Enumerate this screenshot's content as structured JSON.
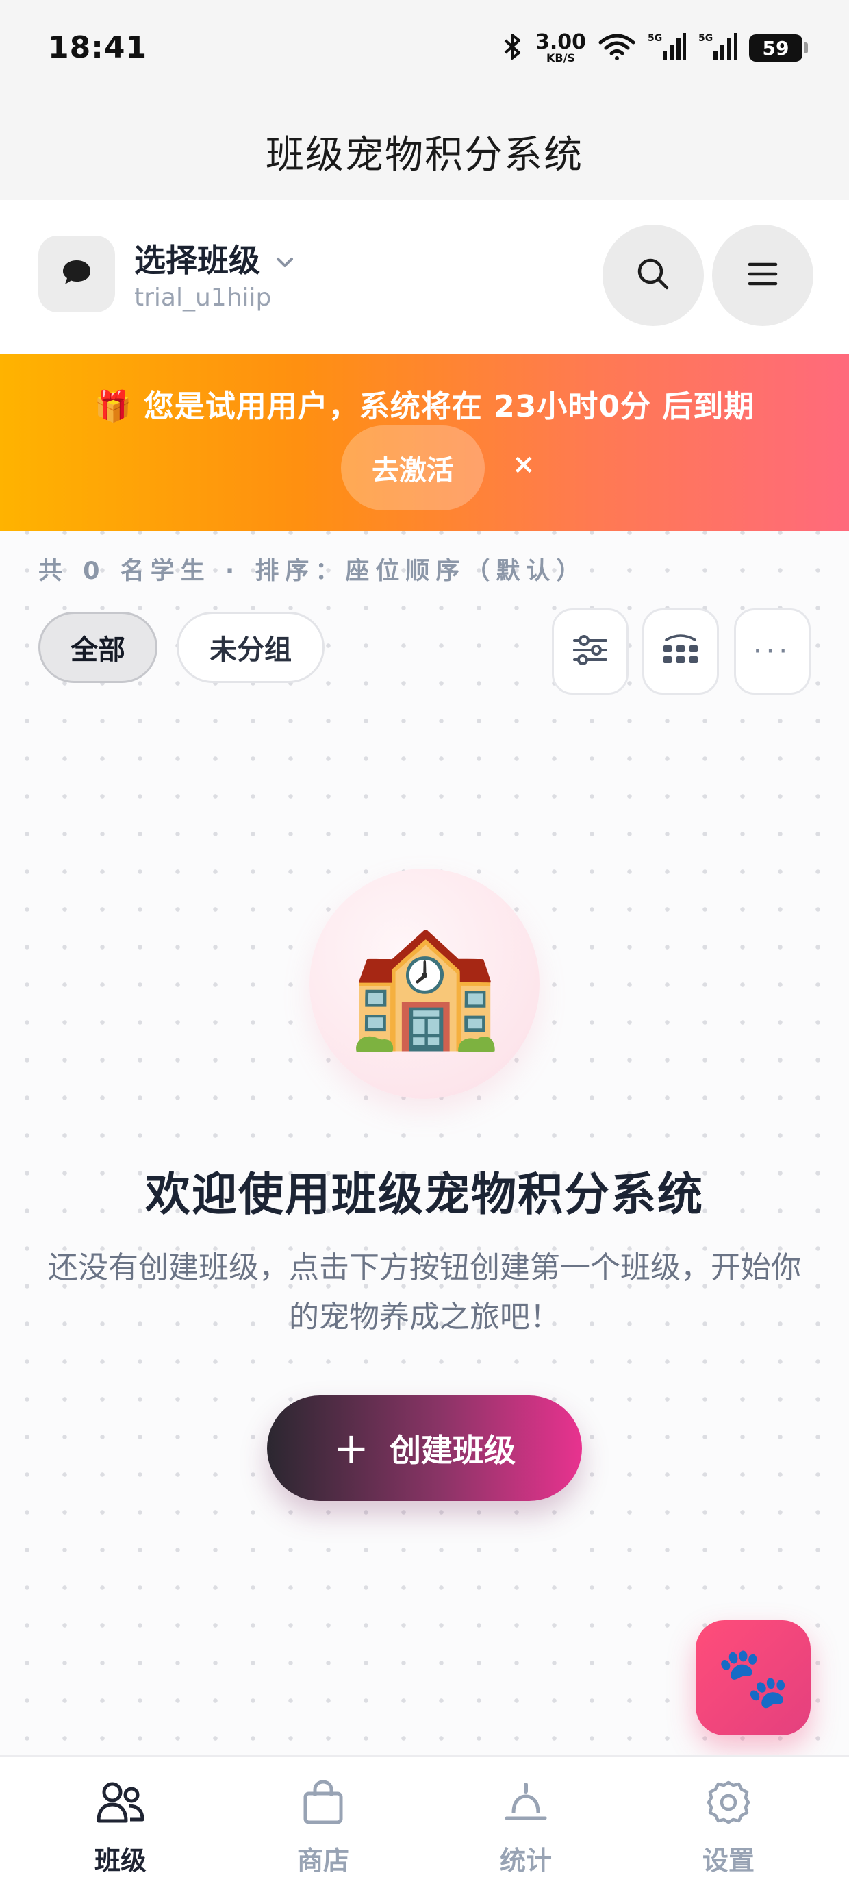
{
  "status_bar": {
    "time": "18:41",
    "speed_value": "3.00",
    "speed_unit": "KB/S",
    "battery": "59",
    "network": "5G"
  },
  "app_title": "班级宠物积分系统",
  "class_header": {
    "title": "选择班级",
    "subtitle": "trial_u1hiip",
    "avatar_icon": "chat-bubble-icon"
  },
  "trial_banner": {
    "emoji": "🎁",
    "text": "您是试用用户，系统将在 23小时0分 后到期",
    "activate_label": "去激活",
    "dismiss": "×",
    "colors": [
      "#ffb300",
      "#ff9010",
      "#ff6a7c"
    ]
  },
  "list_meta": "共 0 名学生 · 排序：座位顺序（默认）",
  "filters": [
    {
      "label": "全部",
      "active": true
    },
    {
      "label": "未分组",
      "active": false
    }
  ],
  "toolbar_icons": [
    "sliders-icon",
    "grid-icon",
    "more-icon"
  ],
  "more_label": "···",
  "empty_state": {
    "emoji": "🏫",
    "title": "欢迎使用班级宠物积分系统",
    "description": "还没有创建班级，点击下方按钮创建第一个班级，开始你的宠物养成之旅吧！",
    "button_label": "创建班级",
    "button_icon": "+"
  },
  "fab_emoji": "🐾",
  "bottom_nav": [
    {
      "label": "班级",
      "icon": "users-icon",
      "active": true
    },
    {
      "label": "商店",
      "icon": "bag-icon",
      "active": false
    },
    {
      "label": "统计",
      "icon": "chart-icon",
      "active": false
    },
    {
      "label": "设置",
      "icon": "gear-icon",
      "active": false
    }
  ],
  "accent_color": "#e8338f"
}
